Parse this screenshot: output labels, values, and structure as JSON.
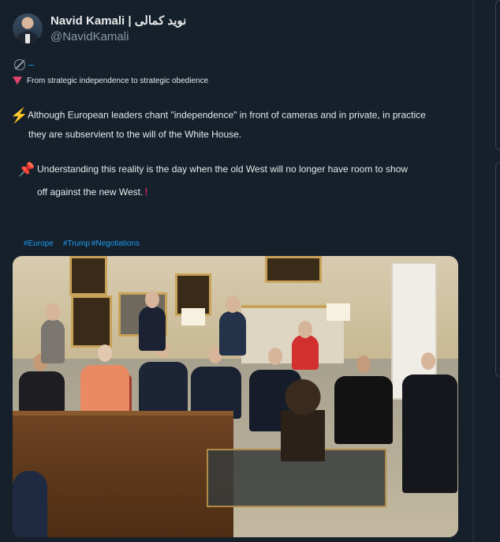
{
  "author": {
    "display_name": "Navid Kamali | نوید کمالی",
    "handle": "@NavidKamali"
  },
  "meta_row": {
    "globe_icon": "globe-icon",
    "dash": "–"
  },
  "post": {
    "line1": "From strategic independence to strategic obedience",
    "line2": "Although European leaders chant \"independence\" in front of cameras and in private, in practice",
    "line3": "they are subservient to the will of the White House.",
    "line4": "Understanding this reality is the day when the old West will no longer have room to show",
    "line5": "off against the new West.",
    "line5_mark": "!",
    "emoji": {
      "line1": "red-triangle-down-icon",
      "line2": "high-voltage-icon",
      "line4": "pushpin-icon"
    }
  },
  "hashtags": [
    "#Europe",
    "#Trump",
    "#Negotiations"
  ],
  "media": {
    "type": "photo",
    "description_icon": "photo-media"
  },
  "colors": {
    "background": "#15202b",
    "link": "#1d9bf0",
    "muted": "#8b98a5",
    "text": "#e7e9ea"
  }
}
